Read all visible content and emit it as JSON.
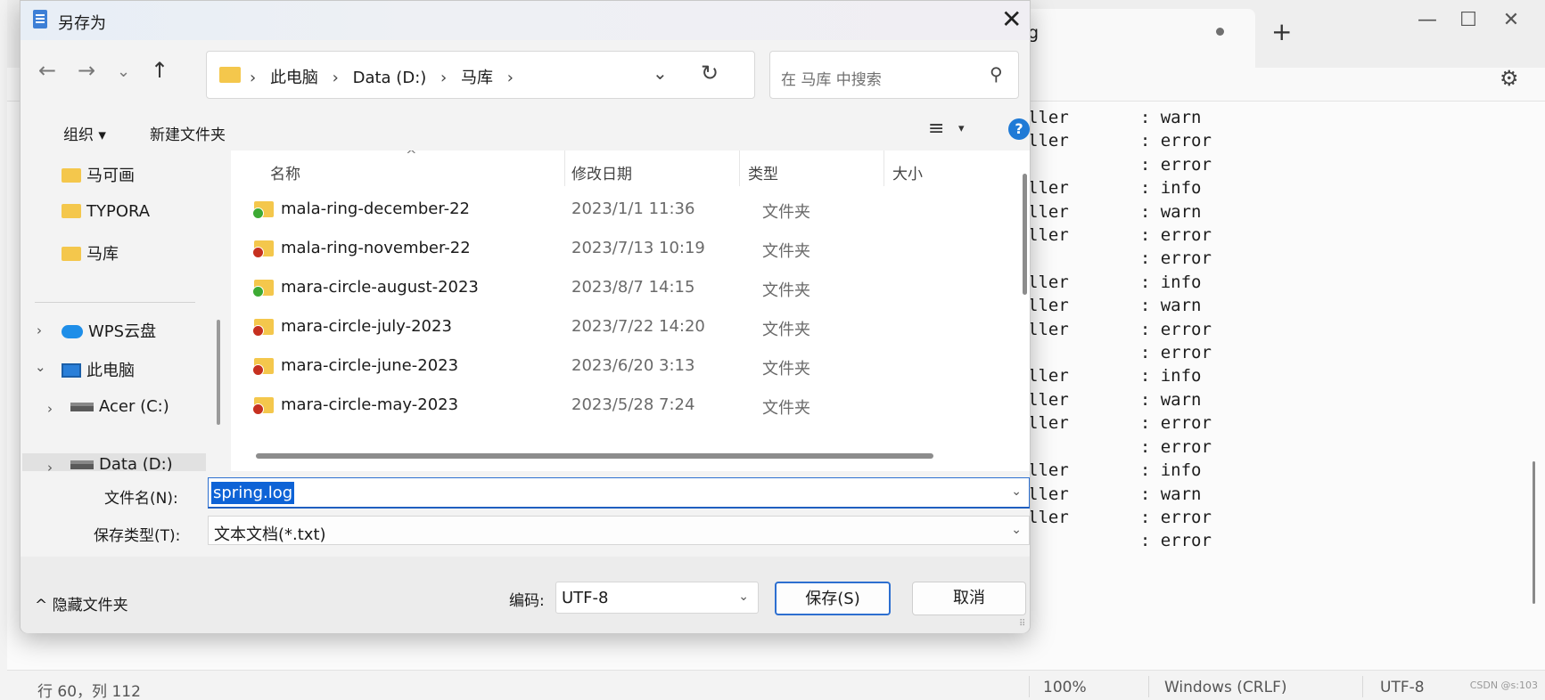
{
  "notepad": {
    "tab_title": "g",
    "plus_label": "+",
    "minimize": "—",
    "maximize": "☐",
    "close": "✕",
    "gear": "⚙",
    "editor_lines": [
      "ller       : warn",
      "ller       : error",
      "           : error",
      "ller       : info",
      "ller       : warn",
      "ller       : error",
      "           : error",
      "ller       : info",
      "ller       : warn",
      "ller       : error",
      "           : error",
      "ller       : info",
      "ller       : warn",
      "ller       : error",
      "           : error",
      "ller       : info",
      "ller       : warn",
      "ller       : error",
      "           : error"
    ],
    "status": {
      "position": "行 60，列 112",
      "zoom": "100%",
      "line_ending": "Windows (CRLF)",
      "encoding": "UTF-8"
    },
    "watermark": "CSDN @s:103"
  },
  "dialog": {
    "title": "另存为",
    "close": "✕",
    "nav": {
      "back": "←",
      "forward": "→",
      "recent": "⌄",
      "up": "↑"
    },
    "address": {
      "crumbs": [
        "此电脑",
        "Data (D:)",
        "马库"
      ],
      "chevron": "›",
      "dropdown": "⌄",
      "refresh": "↻"
    },
    "search": {
      "placeholder": "在 马库 中搜索",
      "icon": "⚲"
    },
    "toolbar": {
      "organize": "组织 ▾",
      "new_folder": "新建文件夹",
      "view_icon": "≡",
      "view_dd": "▾",
      "help": "?"
    },
    "navpane": {
      "items": [
        {
          "label": "马可画",
          "icon": "folder-icon"
        },
        {
          "label": "TYPORA",
          "icon": "folder-icon"
        },
        {
          "label": "马库",
          "icon": "folder-icon"
        },
        {
          "label": "WPS云盘",
          "icon": "cloud-icon",
          "expander": "›"
        },
        {
          "label": "此电脑",
          "icon": "pc-icon",
          "expander": "⌄"
        },
        {
          "label": "Acer (C:)",
          "icon": "drive-icon",
          "expander": "›"
        },
        {
          "label": "Data (D:)",
          "icon": "drive-icon",
          "expander": "›"
        }
      ]
    },
    "columns": {
      "name": "名称",
      "modified": "修改日期",
      "type": "类型",
      "size": "大小",
      "sort": "^"
    },
    "files": [
      {
        "name": "mala-ring-december-22",
        "date": "2023/1/1 11:36",
        "type": "文件夹",
        "status": "ok"
      },
      {
        "name": "mala-ring-november-22",
        "date": "2023/7/13 10:19",
        "type": "文件夹",
        "status": "err"
      },
      {
        "name": "mara-circle-august-2023",
        "date": "2023/8/7 14:15",
        "type": "文件夹",
        "status": "ok"
      },
      {
        "name": "mara-circle-july-2023",
        "date": "2023/7/22 14:20",
        "type": "文件夹",
        "status": "err"
      },
      {
        "name": "mara-circle-june-2023",
        "date": "2023/6/20 3:13",
        "type": "文件夹",
        "status": "err"
      },
      {
        "name": "mara-circle-may-2023",
        "date": "2023/5/28 7:24",
        "type": "文件夹",
        "status": "err"
      }
    ],
    "form": {
      "filename_label": "文件名(N):",
      "filename_value": "spring.log",
      "filetype_label": "保存类型(T):",
      "filetype_value": "文本文档(*.txt)",
      "dropdown": "⌄"
    },
    "footer": {
      "hide_folders": "^  隐藏文件夹",
      "encoding_label": "编码:",
      "encoding_value": "UTF-8",
      "encoding_dd": "⌄",
      "save": "保存(S)",
      "cancel": "取消"
    }
  }
}
